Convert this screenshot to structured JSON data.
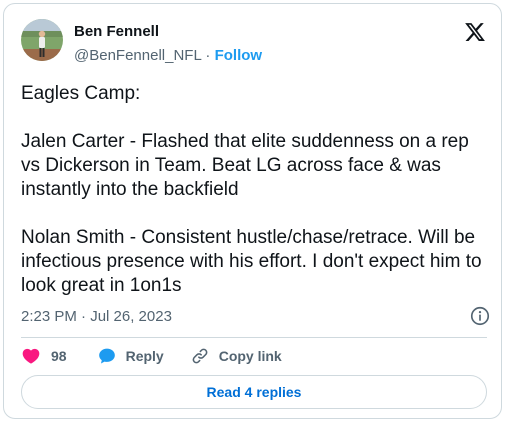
{
  "author": {
    "name": "Ben Fennell",
    "handle": "@BenFennell_NFL",
    "separator": "·",
    "follow_label": "Follow"
  },
  "tweet": {
    "paragraphs": [
      "Eagles Camp:",
      "Jalen Carter - Flashed that elite suddenness on a rep vs Dickerson in Team. Beat LG across face & was instantly into the backfield",
      "Nolan Smith - Consistent hustle/chase/retrace. Will be infectious presence with his effort. I don't expect him to look great in 1on1s"
    ],
    "timestamp": "2:23 PM · Jul 26, 2023"
  },
  "actions": {
    "like_count": "98",
    "reply_label": "Reply",
    "copy_link_label": "Copy link"
  },
  "read_replies_label": "Read 4 replies",
  "icons": {
    "brand": "x-logo-icon",
    "info": "info-icon",
    "like": "heart-icon",
    "reply": "speech-bubble-icon",
    "copy": "link-icon"
  },
  "colors": {
    "text_primary": "#0f1419",
    "text_secondary": "#536471",
    "accent_blue": "#1d9bf0",
    "like_pink": "#f91880",
    "reply_blue": "#1d9bf0",
    "border": "#cfd9de",
    "read_replies_blue": "#006fd6"
  }
}
